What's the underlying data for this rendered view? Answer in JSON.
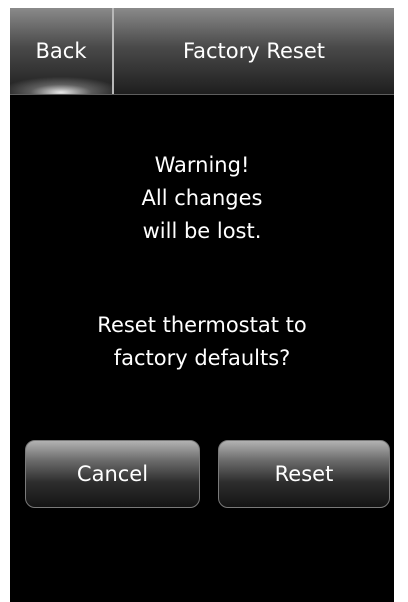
{
  "header": {
    "back_label": "Back",
    "title": "Factory Reset"
  },
  "warning": {
    "lines": [
      "Warning!",
      "All changes",
      "will be lost."
    ]
  },
  "question": {
    "lines": [
      "Reset thermostat to",
      "factory defaults?"
    ]
  },
  "actions": {
    "cancel_label": "Cancel",
    "reset_label": "Reset"
  },
  "colors": {
    "background": "#000000",
    "text": "#ffffff",
    "bar_top": "#8a8a8a",
    "button_top": "#b2b2b2"
  }
}
